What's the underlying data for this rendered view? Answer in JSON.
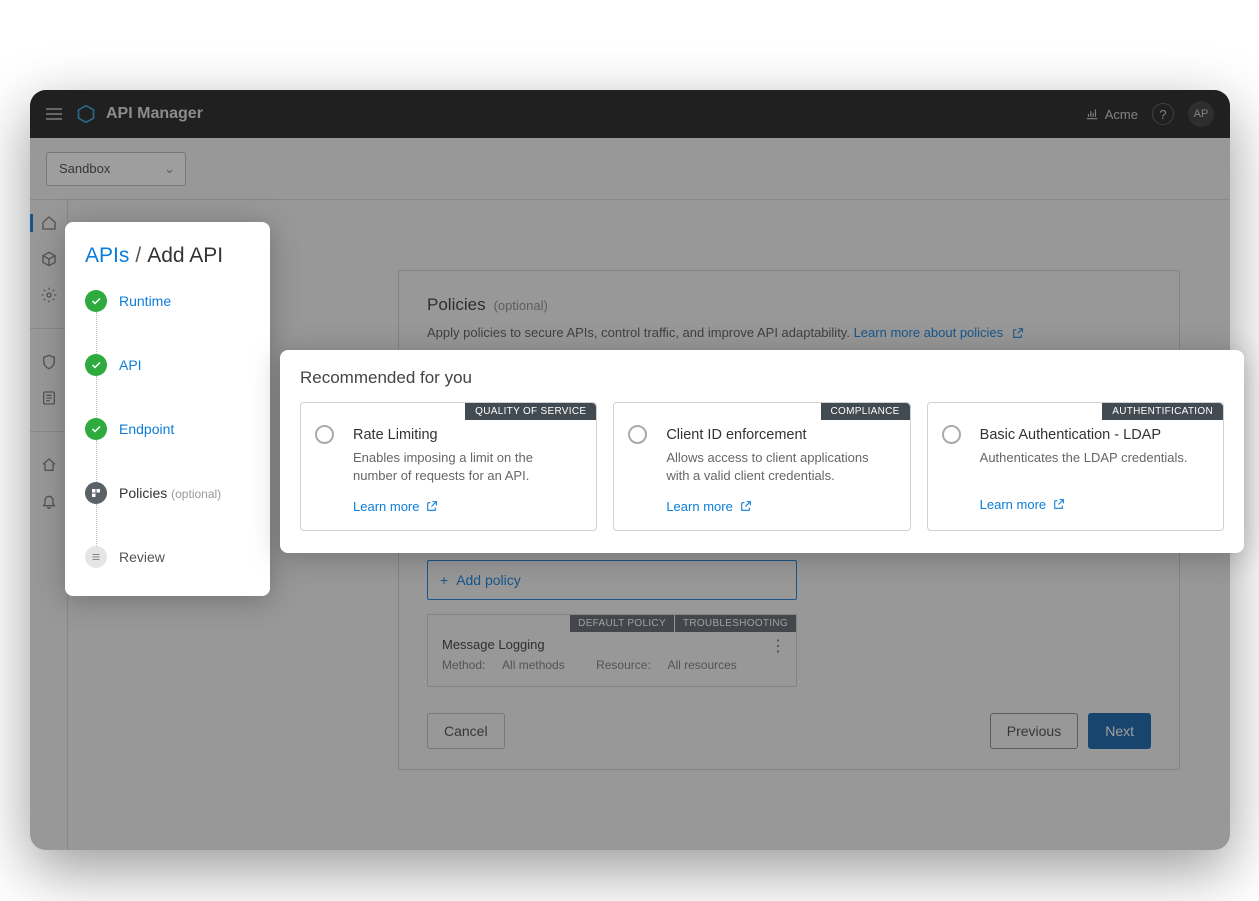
{
  "topbar": {
    "app_title": "API Manager",
    "org_name": "Acme",
    "help_char": "?",
    "avatar_initials": "AP"
  },
  "env": {
    "selected": "Sandbox"
  },
  "breadcrumb": {
    "root": "APIs",
    "sep": "/",
    "current": "Add API"
  },
  "steps": {
    "runtime": "Runtime",
    "api": "API",
    "endpoint": "Endpoint",
    "policies": "Policies",
    "policies_optional": "(optional)",
    "review": "Review"
  },
  "panel": {
    "title": "Policies",
    "title_optional": "(optional)",
    "description": "Apply policies to secure APIs, control traffic, and improve API adaptability. ",
    "learn_more": "Learn more about policies",
    "add_policy": "Add policy",
    "cancel": "Cancel",
    "previous": "Previous",
    "next": "Next"
  },
  "existing_policy": {
    "title": "Message Logging",
    "method_label": "Method:",
    "method_val": "All methods",
    "resource_label": "Resource:",
    "resource_val": "All resources",
    "tag1": "DEFAULT POLICY",
    "tag2": "TROUBLESHOOTING"
  },
  "reco": {
    "heading": "Recommended for you",
    "learn_more_label": "Learn more",
    "items": [
      {
        "tag": "QUALITY OF SERVICE",
        "title": "Rate Limiting",
        "desc": "Enables imposing a limit on the number of requests for an API."
      },
      {
        "tag": "COMPLIANCE",
        "title": "Client ID enforcement",
        "desc": " Allows access to client applications with a valid client credentials."
      },
      {
        "tag": "AUTHENTIFICATION",
        "title": "Basic Authentication - LDAP",
        "desc": "Authenticates the LDAP credentials."
      }
    ]
  }
}
